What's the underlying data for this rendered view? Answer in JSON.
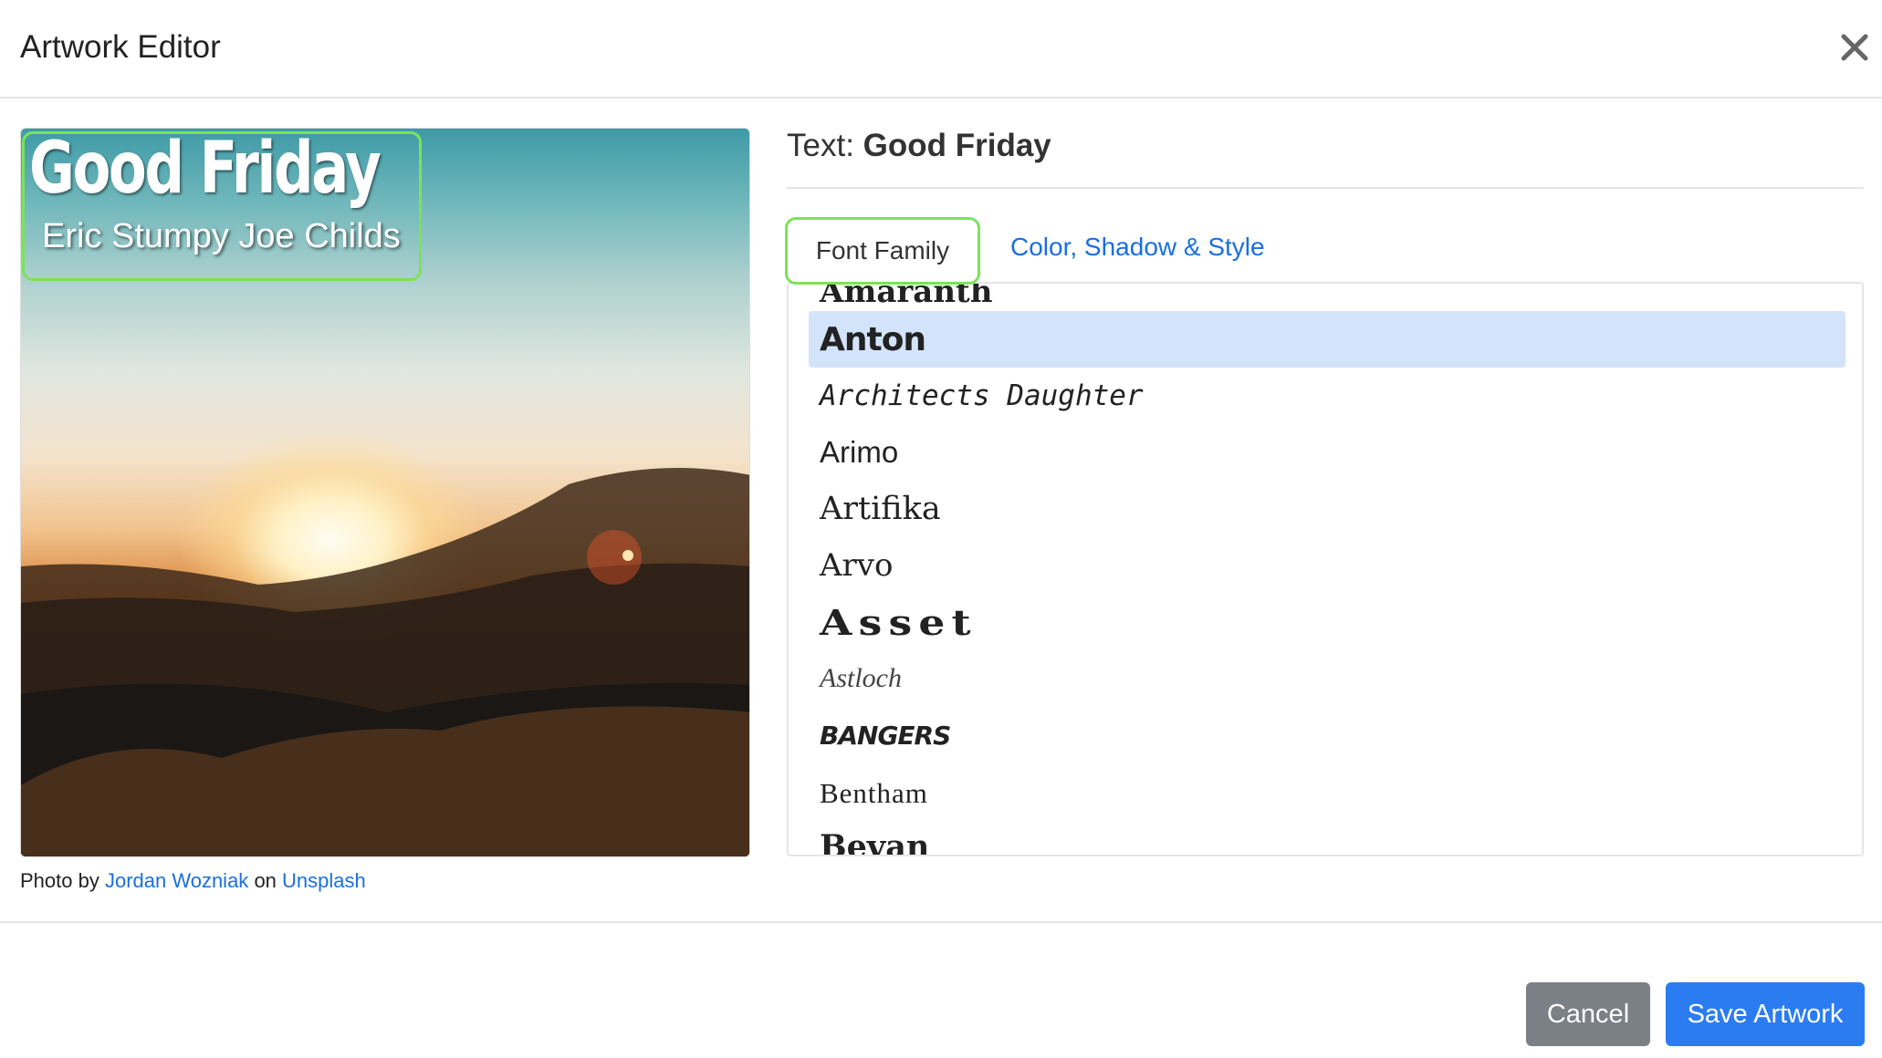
{
  "header": {
    "title": "Artwork Editor"
  },
  "artwork": {
    "title": "Good Friday",
    "subtitle": "Eric Stumpy Joe Childs"
  },
  "credit": {
    "prefix": "Photo by",
    "author": "Jordan Wozniak",
    "on": "on",
    "source": "Unsplash"
  },
  "editor": {
    "label": "Text:",
    "value": "Good Friday"
  },
  "tabs": {
    "font_family": "Font Family",
    "color_style": "Color, Shadow & Style"
  },
  "fonts": {
    "partial": "Amaranth",
    "items": [
      "Anton",
      "Architects Daughter",
      "Arimo",
      "Artifika",
      "Arvo",
      "Asset",
      "Astloch",
      "Bangers",
      "Bentham",
      "Bevan"
    ],
    "selected": "Anton"
  },
  "footer": {
    "cancel": "Cancel",
    "save": "Save Artwork"
  }
}
